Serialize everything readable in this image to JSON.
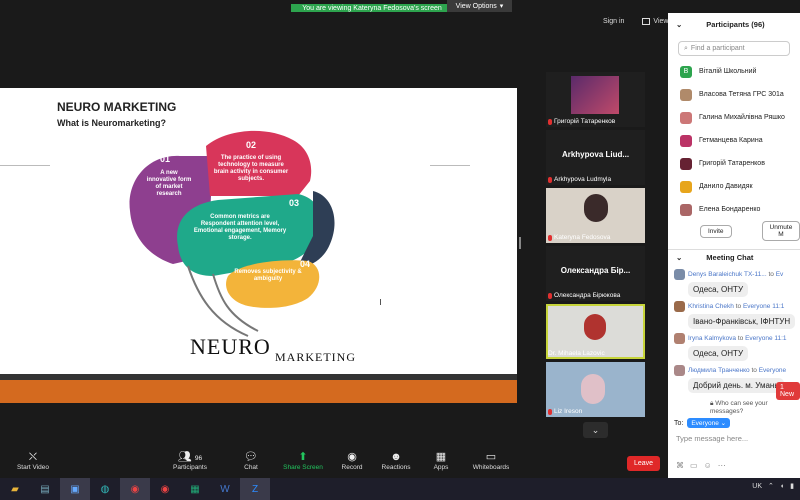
{
  "banner": {
    "message": "You are viewing Kateryna Fedosova's screen",
    "view_options": "View Options"
  },
  "top_right": {
    "sign_in": "Sign in",
    "view": "View"
  },
  "slide": {
    "title": "NEURO MARKETING",
    "subtitle": "What is Neuromarketing?",
    "segments": [
      {
        "num": "01",
        "text": "A new innovative form of market research"
      },
      {
        "num": "02",
        "text": "The practice of using technology to measure brain activity in consumer subjects."
      },
      {
        "num": "03",
        "text": "Common metrics are Respondent attention level, Emotional engagement, Memory storage."
      },
      {
        "num": "04",
        "text": "Removes subjectivity & ambiguity"
      }
    ],
    "logo_neuro": "NEURO",
    "logo_marketing": "MARKETING"
  },
  "thumbnails": [
    {
      "name": "Григорій Татаренков",
      "big": ""
    },
    {
      "name": "Arkhypova Ludmyla",
      "big": "Arkhypova Liud..."
    },
    {
      "name": "Kateryna Fedosova",
      "big": ""
    },
    {
      "name": "Олександра Бірюкова",
      "big": "Олександра Бір..."
    },
    {
      "name": "Dr. Mihaela Lazovic",
      "big": ""
    },
    {
      "name": "Liz Ireson",
      "big": ""
    }
  ],
  "participants": {
    "header": "Participants (96)",
    "search_placeholder": "Find a participant",
    "list": [
      {
        "name": "Віталій Школьний",
        "initial": "В",
        "color": "#2da44e"
      },
      {
        "name": "Власова Тетяна ГРС 301а",
        "initial": "",
        "color": "#b08a6a"
      },
      {
        "name": "Галина Михайлівна Ряшко",
        "initial": "",
        "color": "#c77"
      },
      {
        "name": "Гетманцева Карина",
        "initial": "",
        "color": "#b36"
      },
      {
        "name": "Григорій Татаренков",
        "initial": "",
        "color": "#623"
      },
      {
        "name": "Данило Давидяк",
        "initial": "",
        "color": "#e7a51c"
      },
      {
        "name": "Елена Бондаренко",
        "initial": "",
        "color": "#a66"
      }
    ],
    "invite": "Invite",
    "unmute": "Unmute M"
  },
  "chat": {
    "header": "Meeting Chat",
    "messages": [
      {
        "from": "Denys Baraleichuk ТХ-11...",
        "to": "Ev",
        "text": "Одеса, ОНТУ",
        "avatar": "#7a8ca8"
      },
      {
        "from": "Khristina Chekh",
        "to": "Everyone 11:1",
        "text": "Івано-Франківськ, ІФНТУН",
        "avatar": "#9a6a4a"
      },
      {
        "from": "Iryna Kalmykova",
        "to": "Everyone 11:1",
        "text": "Одеса, ОНТУ",
        "avatar": "#b08070"
      },
      {
        "from": "Людмила Транченко",
        "to": "Everyone",
        "text": "Добрий день. м. Умань",
        "avatar": "#a88"
      }
    ],
    "to_word": "to",
    "new_badge": "1 New",
    "who_can_see": "Who can see your messages?",
    "to_label": "To:",
    "to_value": "Everyone",
    "input_placeholder": "Type message here..."
  },
  "toolbar": {
    "start_video": "Start Video",
    "participants": "Participants",
    "participants_count": "96",
    "chat": "Chat",
    "share_screen": "Share Screen",
    "record": "Record",
    "reactions": "Reactions",
    "apps": "Apps",
    "whiteboards": "Whiteboards",
    "leave": "Leave"
  },
  "tray": {
    "lang": "UK"
  }
}
